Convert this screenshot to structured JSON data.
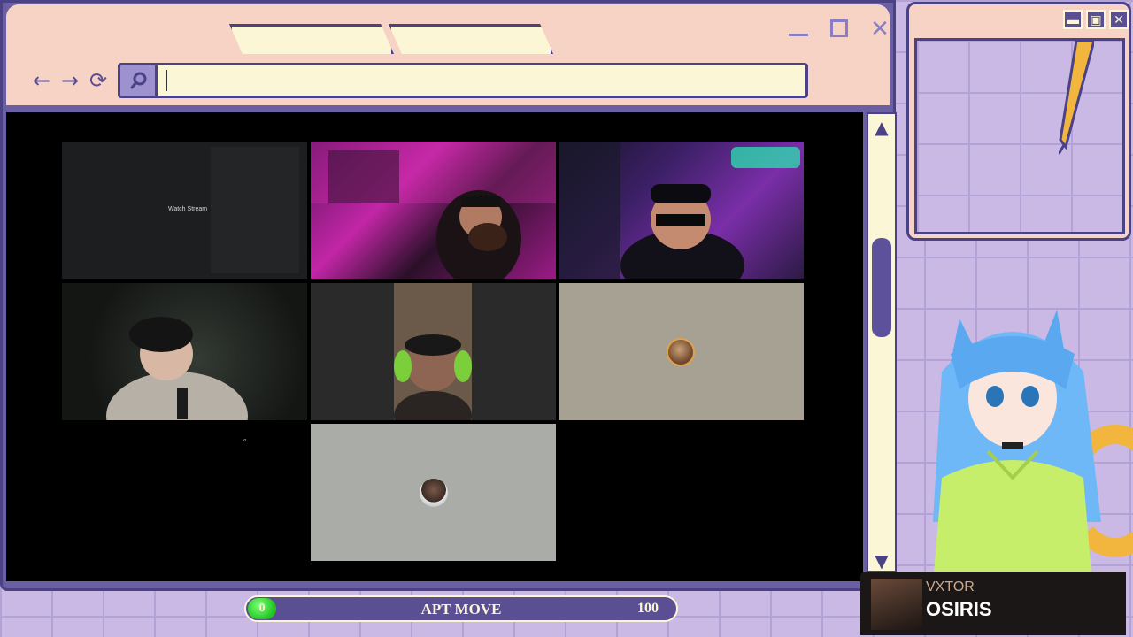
{
  "browser": {
    "address_value": "",
    "nav": {
      "back": "←",
      "forward": "→",
      "reload": "⟳"
    },
    "window_controls": {
      "minimize": "minimize-icon",
      "maximize": "maximize-icon",
      "close": "✕"
    }
  },
  "call": {
    "tiles": [
      {
        "id": "screen-share",
        "label": "Watch Stream"
      },
      {
        "id": "participant-2"
      },
      {
        "id": "participant-3"
      },
      {
        "id": "participant-4"
      },
      {
        "id": "participant-5"
      },
      {
        "id": "participant-6-avatar"
      },
      {
        "id": "participant-7-avatar"
      }
    ]
  },
  "scrollbar": {
    "up": "▲",
    "down": "▼"
  },
  "progress": {
    "title": "APT MOVE",
    "current": "0",
    "max": "100",
    "fraction": 0
  },
  "side_window": {
    "minimize": "▬",
    "maximize": "▣",
    "close": "✕"
  },
  "now_playing": {
    "artist": "VXTOR",
    "track": "OSIRIS"
  },
  "colors": {
    "frame": "#4b4286",
    "panel": "#6b5fa3",
    "tabbar": "#f7d3c6",
    "cream": "#fbf6d6",
    "progress_knob": "#21c51f",
    "accent_yellow": "#f2b63e"
  }
}
